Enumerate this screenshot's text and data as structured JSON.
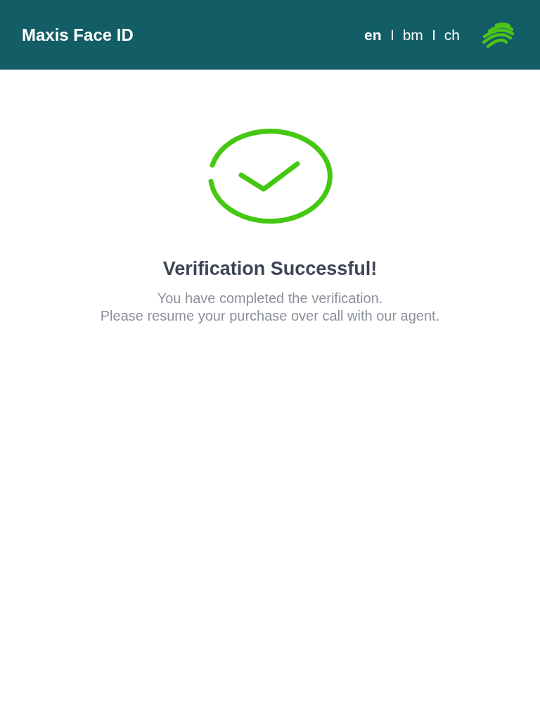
{
  "header": {
    "title": "Maxis Face ID",
    "languages": [
      {
        "label": "en",
        "selected": true
      },
      {
        "label": "bm",
        "selected": false
      },
      {
        "label": "ch",
        "selected": false
      }
    ]
  },
  "result": {
    "heading": "Verification Successful!",
    "lines": [
      "You have completed the verification.",
      "Please resume your purchase over call with our agent."
    ]
  }
}
